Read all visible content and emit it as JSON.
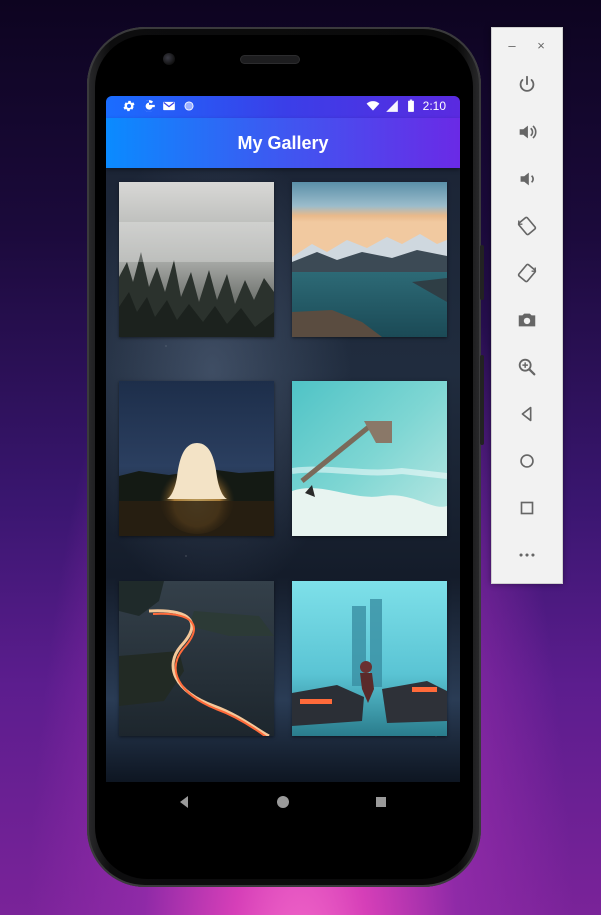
{
  "status_bar": {
    "time": "2:10",
    "left_icons": [
      "settings-icon",
      "google-icon",
      "gmail-icon",
      "assistant-dot-icon"
    ],
    "right_icons": [
      "wifi-icon",
      "signal-icon",
      "battery-icon"
    ]
  },
  "app_bar": {
    "title": "My Gallery"
  },
  "gallery": {
    "images": [
      {
        "name": "foggy-forest"
      },
      {
        "name": "mountain-lake"
      },
      {
        "name": "ghost-field"
      },
      {
        "name": "turquoise-pier"
      },
      {
        "name": "coastal-road-lights"
      },
      {
        "name": "astronaut-city"
      }
    ]
  },
  "nav_bar": {
    "buttons": [
      "back-icon",
      "home-icon",
      "recents-icon"
    ]
  },
  "toolbar": {
    "minimize_label": "–",
    "close_label": "×",
    "buttons": [
      "power",
      "volume-up",
      "volume-down",
      "rotate-left",
      "rotate-right",
      "screenshot",
      "zoom",
      "back",
      "home",
      "overview",
      "more"
    ]
  },
  "colors": {
    "app_bar_start": "#0a8bff",
    "app_bar_end": "#6a2ae6",
    "status_bar": "#3a3fe8",
    "toolbar_bg": "#f2f2f2"
  }
}
